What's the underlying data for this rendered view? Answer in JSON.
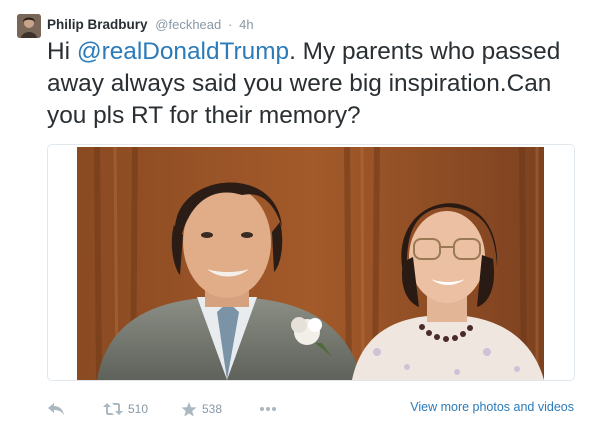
{
  "tweet": {
    "author_name": "Philip Bradbury",
    "author_handle": "@feckhead",
    "separator": "·",
    "timestamp": "4h",
    "text_before": "Hi ",
    "mention": "@realDonaldTrump",
    "text_after": ". My parents who passed away always said you were big inspiration.Can you pls RT for their memory?"
  },
  "actions": {
    "reply_icon": "reply-icon",
    "retweet_icon": "retweet-icon",
    "retweet_count": "510",
    "favorite_icon": "star-icon",
    "favorite_count": "538",
    "more_icon": "more-dots-icon",
    "view_more_label": "View more photos and videos"
  },
  "colors": {
    "link": "#2b7bb9",
    "text": "#292f33",
    "muted": "#8899a6",
    "icon": "#aab8c2",
    "border": "#e1e8ed"
  }
}
